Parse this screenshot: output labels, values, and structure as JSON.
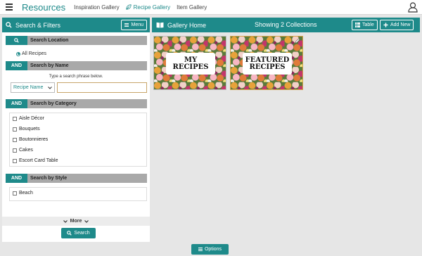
{
  "header": {
    "brand": "Resources",
    "nav": [
      "Inspiration Gallery",
      "Recipe Gallery",
      "Item Gallery"
    ],
    "active_nav": "Recipe Gallery"
  },
  "left_panel": {
    "title": "Search & Filters",
    "menu_label": "Menu",
    "location": {
      "label": "Search Location",
      "option": "All Recipes"
    },
    "by_name": {
      "tag": "AND",
      "label": "Search by Name",
      "hint": "Type a search phrase below.",
      "select_value": "Recipe Name",
      "input_value": ""
    },
    "by_category": {
      "tag": "AND",
      "label": "Search by Category",
      "items": [
        "Aisle Décor",
        "Bouquets",
        "Boutonnieres",
        "Cakes",
        "Escort Card Table"
      ]
    },
    "by_style": {
      "tag": "AND",
      "label": "Search by Style",
      "items": [
        "Beach"
      ]
    },
    "more_label": "More",
    "search_label": "Search"
  },
  "right_panel": {
    "title": "Gallery Home",
    "count_text": "Showing 2 Collections",
    "table_label": "Table",
    "add_label": "Add New",
    "cards": [
      {
        "label_line1": "MY",
        "label_line2": "RECIPES"
      },
      {
        "label_line1": "FEATURED",
        "label_line2": "RECIPES"
      }
    ]
  },
  "footer": {
    "options_label": "Options"
  },
  "colors": {
    "accent": "#1e8a8a",
    "section_gray": "#a9a9a9",
    "selected_border": "#d7a24a"
  }
}
